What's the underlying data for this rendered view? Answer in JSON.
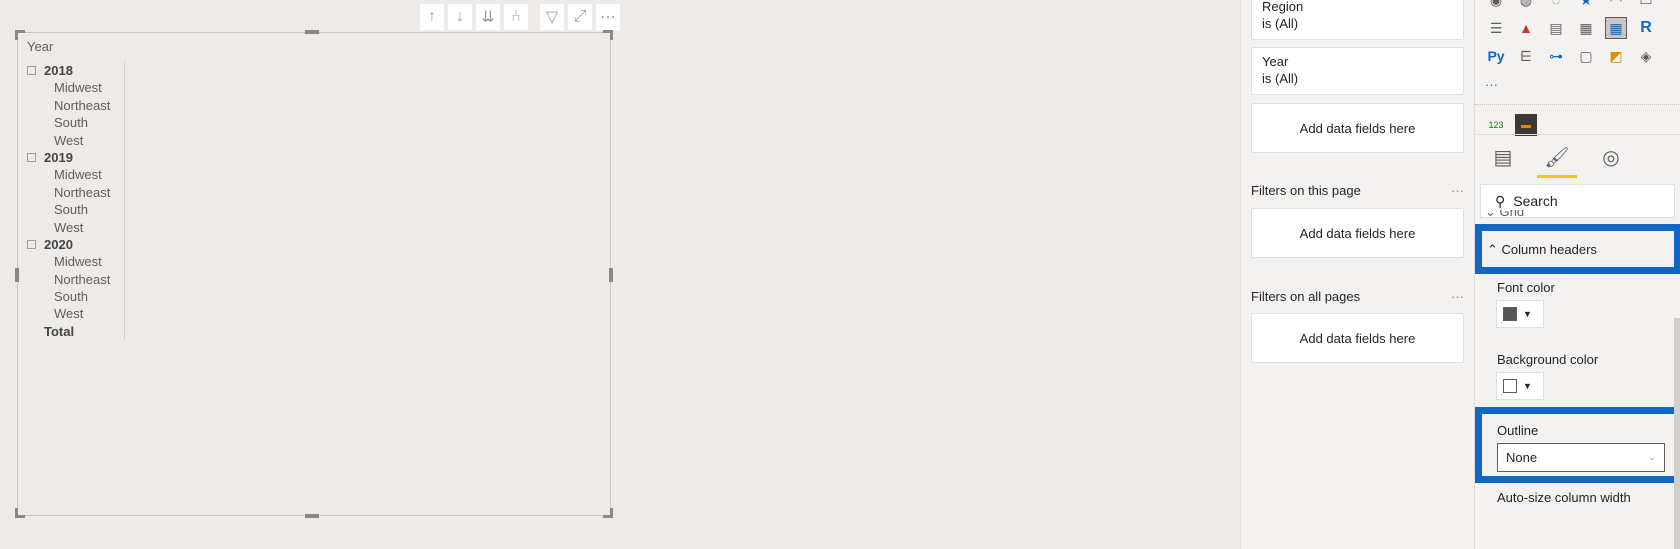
{
  "visual": {
    "toolbar": [
      {
        "icon": "arrow-up-icon",
        "g": "↑"
      },
      {
        "icon": "arrow-down-icon",
        "g": "↓"
      },
      {
        "icon": "double-arrow-down-icon",
        "g": "⇊"
      },
      {
        "icon": "expand-hierarchy-icon",
        "g": "⑃"
      },
      {
        "icon": "filter-icon",
        "g": "▽"
      },
      {
        "icon": "focus-mode-icon",
        "g": "⤢"
      },
      {
        "icon": "more-options-icon",
        "g": "⋯"
      }
    ],
    "header": "Year",
    "rows": [
      {
        "label": "2018",
        "type": "year"
      },
      {
        "label": "Midwest"
      },
      {
        "label": "Northeast"
      },
      {
        "label": "South"
      },
      {
        "label": "West"
      },
      {
        "label": "2019",
        "type": "year"
      },
      {
        "label": "Midwest"
      },
      {
        "label": "Northeast"
      },
      {
        "label": "South"
      },
      {
        "label": "West"
      },
      {
        "label": "2020",
        "type": "year"
      },
      {
        "label": "Midwest"
      },
      {
        "label": "Northeast"
      },
      {
        "label": "South"
      },
      {
        "label": "West"
      },
      {
        "label": "Total",
        "type": "total"
      }
    ]
  },
  "filters": {
    "visual_filters": [
      {
        "field": "Region",
        "state": "is (All)"
      },
      {
        "field": "Year",
        "state": "is (All)"
      }
    ],
    "add_label": "Add data fields here",
    "page_section": "Filters on this page",
    "all_section": "Filters on all pages",
    "more": "···"
  },
  "viz": {
    "more": "···",
    "search_placeholder": "Search",
    "grid": "Grid",
    "column_headers": "Column headers",
    "font_color_label": "Font color",
    "font_color": "#555555",
    "background_color_label": "Background color",
    "background_color": "#ffffff",
    "outline_label": "Outline",
    "outline_value": "None",
    "autosize_label": "Auto-size column width",
    "highlight_color": "#1168c3",
    "active_tab_color": "#f2c811"
  }
}
